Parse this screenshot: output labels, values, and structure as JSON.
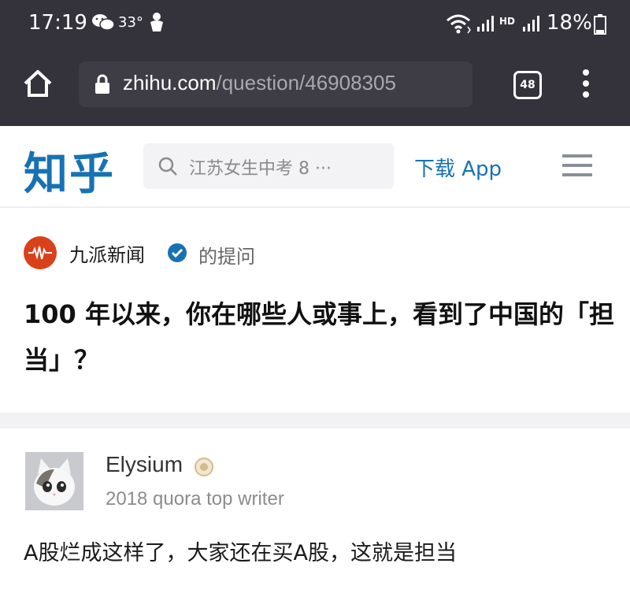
{
  "status_bar": {
    "time": "17:19",
    "temperature": "33°",
    "network_label": "HD",
    "battery": "18%",
    "icons": [
      "wechat-icon",
      "weather-icon",
      "wifi-icon",
      "signal-icon",
      "battery-icon"
    ]
  },
  "browser": {
    "url_domain": "zhihu.com",
    "url_path": "/question/46908305",
    "tab_count": "48",
    "icons": [
      "home-icon",
      "lock-icon",
      "menu-dots-icon"
    ]
  },
  "zhihu_header": {
    "logo": "知乎",
    "search_placeholder": "江苏女生中考 8 ···",
    "download_label": "下载 App",
    "icons": [
      "search-icon",
      "hamburger-icon"
    ]
  },
  "question": {
    "asker_name": "九派新闻",
    "asker_suffix": "的提问",
    "title": "100 年以来，你在哪些人或事上，看到了中国的「担当」？"
  },
  "answer": {
    "author_name": "Elysium",
    "author_desc": "2018 quora top writer",
    "text": "A股烂成这样了，大家还在买A股，这就是担当"
  },
  "colors": {
    "chrome_bg": "#34333c",
    "url_box_bg": "#3e3d46",
    "zhihu_blue": "#1772b4",
    "asker_avatar": "#d9411b",
    "divider": "#f2f2f4"
  }
}
